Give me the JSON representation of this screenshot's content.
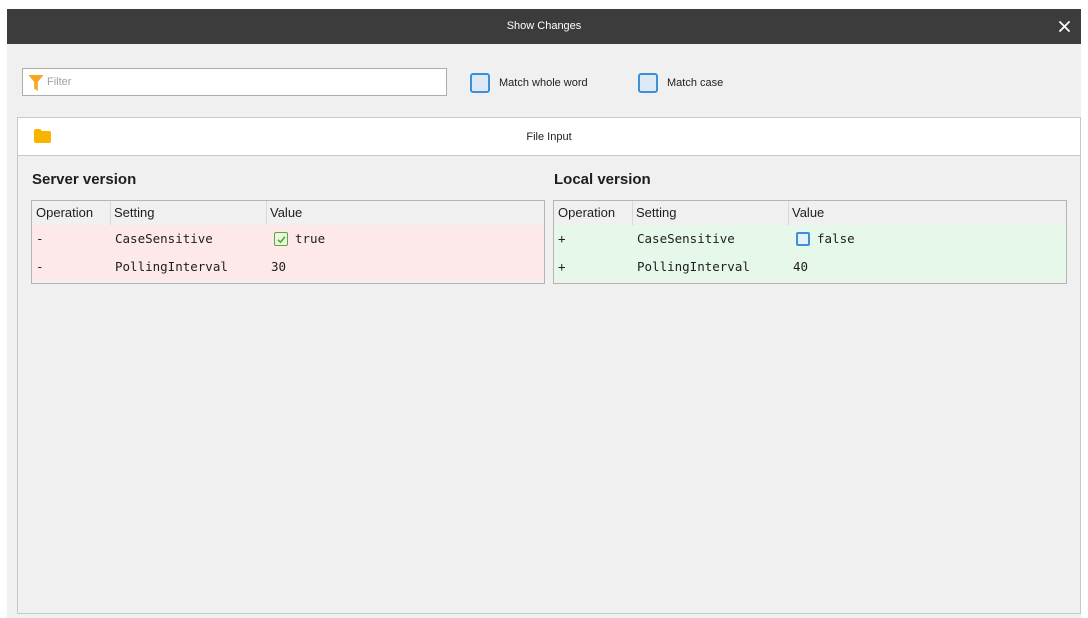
{
  "window": {
    "title": "Show Changes",
    "close_icon": "close-icon"
  },
  "filter": {
    "placeholder": "Filter",
    "value": "",
    "icon": "funnel-icon",
    "icon_color": "#f5a623"
  },
  "options": {
    "match_whole_word": {
      "label": "Match whole word",
      "checked": false
    },
    "match_case": {
      "label": "Match case",
      "checked": false
    },
    "accent_color": "#3d8fd8"
  },
  "tab": {
    "label": "File Input",
    "icon": "folder-icon",
    "icon_color": "#f7b500"
  },
  "server": {
    "title": "Server version",
    "columns": [
      "Operation",
      "Setting",
      "Value"
    ],
    "row_color": "#fde9e9",
    "rows": [
      {
        "operation": "-",
        "setting": "CaseSensitive",
        "value": "true",
        "value_is_checkbox": true,
        "checked": true
      },
      {
        "operation": "-",
        "setting": "PollingInterval",
        "value": "30"
      }
    ]
  },
  "local": {
    "title": "Local version",
    "columns": [
      "Operation",
      "Setting",
      "Value"
    ],
    "row_color": "#e5f8e9",
    "rows": [
      {
        "operation": "+",
        "setting": "CaseSensitive",
        "value": "false",
        "value_is_checkbox": true,
        "checked": false
      },
      {
        "operation": "+",
        "setting": "PollingInterval",
        "value": "40"
      }
    ]
  }
}
